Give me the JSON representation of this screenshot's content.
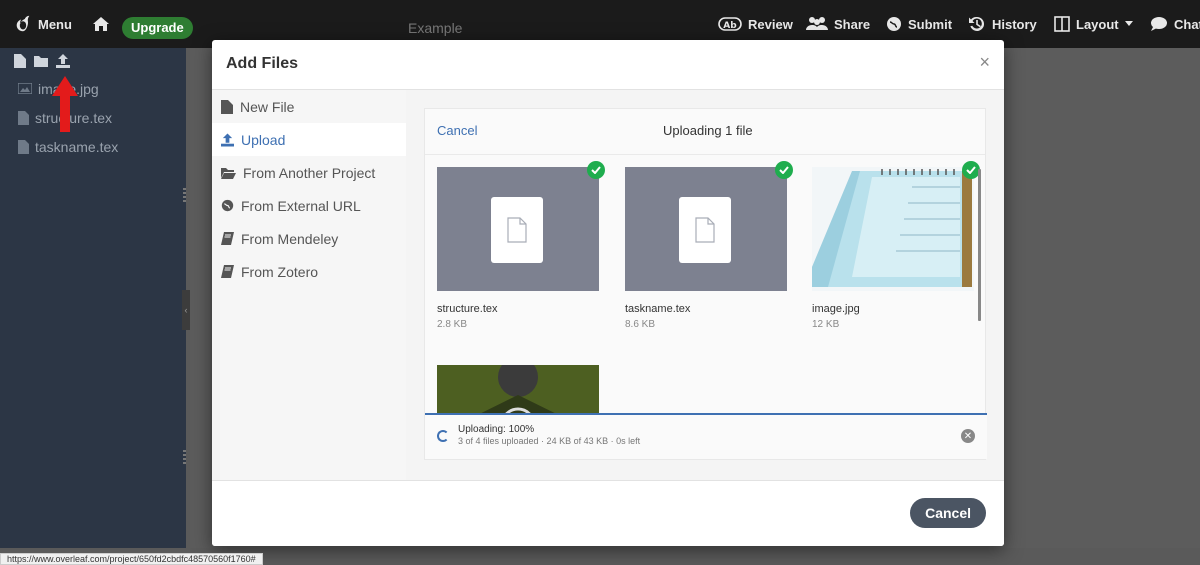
{
  "toolbar": {
    "menu_label": "Menu",
    "upgrade_label": "Upgrade",
    "project_title": "Example",
    "review_label": "Review",
    "share_label": "Share",
    "submit_label": "Submit",
    "history_label": "History",
    "layout_label": "Layout",
    "chat_label": "Chat"
  },
  "file_tree": {
    "files": [
      {
        "name": "image.jpg",
        "icon": "image-file-icon"
      },
      {
        "name": "structure.tex",
        "icon": "file-icon"
      },
      {
        "name": "taskname.tex",
        "icon": "file-icon"
      }
    ]
  },
  "modal": {
    "title": "Add Files",
    "close_symbol": "×",
    "nav": [
      {
        "label": "New File",
        "icon": "new-file-icon"
      },
      {
        "label": "Upload",
        "icon": "upload-icon",
        "active": true
      },
      {
        "label": "From Another Project",
        "icon": "folder-open-icon"
      },
      {
        "label": "From External URL",
        "icon": "globe-icon"
      },
      {
        "label": "From Mendeley",
        "icon": "book-icon"
      },
      {
        "label": "From Zotero",
        "icon": "book-icon"
      }
    ],
    "uploader": {
      "cancel_label": "Cancel",
      "title": "Uploading 1 file",
      "files": [
        {
          "name": "structure.tex",
          "size": "2.8 KB",
          "done": true
        },
        {
          "name": "taskname.tex",
          "size": "8.6 KB",
          "done": true
        },
        {
          "name": "image.jpg",
          "size": "12 KB",
          "done": true
        }
      ],
      "status_main": "Uploading: 100%",
      "status_sub": "3 of 4 files uploaded · 24 KB of 43 KB · 0s left",
      "progress": 1.0
    },
    "footer_cancel_label": "Cancel"
  },
  "statusbar": {
    "url": "https://www.overleaf.com/project/650fd2cbdfc48570560f1760#"
  },
  "colors": {
    "accent": "#3e70b2",
    "success": "#1fad4e",
    "upgrade": "#2e7d32",
    "sidebar": "#2c3645",
    "annotation": "#e31b1b"
  }
}
